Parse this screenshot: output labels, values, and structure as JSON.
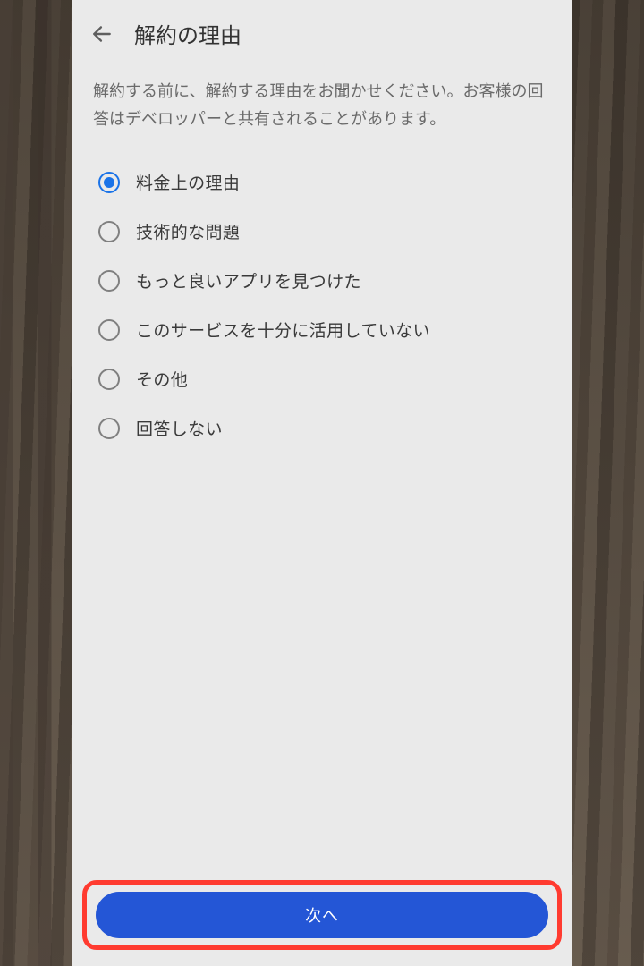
{
  "header": {
    "title": "解約の理由"
  },
  "description": "解約する前に、解約する理由をお聞かせください。お客様の回答はデベロッパーと共有されることがあります。",
  "options": [
    {
      "label": "料金上の理由",
      "selected": true
    },
    {
      "label": "技術的な問題",
      "selected": false
    },
    {
      "label": "もっと良いアプリを見つけた",
      "selected": false
    },
    {
      "label": "このサービスを十分に活用していない",
      "selected": false
    },
    {
      "label": "その他",
      "selected": false
    },
    {
      "label": "回答しない",
      "selected": false
    }
  ],
  "footer": {
    "next_label": "次へ"
  }
}
